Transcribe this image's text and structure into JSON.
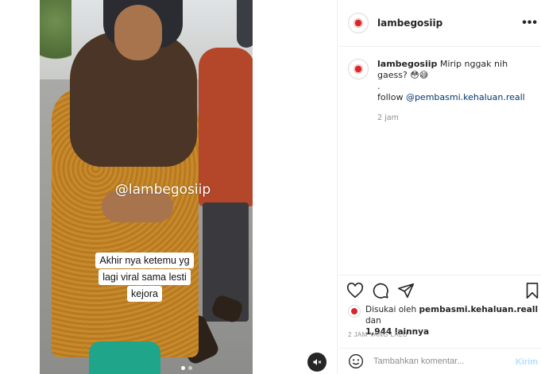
{
  "post": {
    "username": "lambegosiip",
    "video": {
      "watermark": "@lambegosiip",
      "caption_lines": [
        "Akhir nya ketemu yg",
        "lagi viral sama lesti",
        "kejora"
      ],
      "slide_count": 2,
      "active_slide": 1
    }
  },
  "comment": {
    "username": "lambegosiip",
    "text": "Mirip nggak nih gaess?",
    "emoji": "😳😅",
    "dot": ".",
    "follow_label": "follow",
    "mention": "@pembasmi.kehaluan.reall",
    "time": "2 jam"
  },
  "likes": {
    "prefix": "Disukai oleh",
    "user": "pembasmi.kehaluan.reall",
    "connector": "dan",
    "count": "1,944 lainnya"
  },
  "posted_ago": "2 JAM YANG LALU",
  "add_comment": {
    "placeholder": "Tambahkan komentar...",
    "emoji": "☺",
    "post_label": "Kirim"
  },
  "icons": [
    "more-icon",
    "heart-icon",
    "comment-icon",
    "share-icon",
    "bookmark-icon",
    "emoji-icon",
    "mute-icon"
  ],
  "colors": {
    "accent": "#0095f6",
    "link": "#00376b",
    "muted": "#8e8e8e",
    "post_disabled": "#b2dffc"
  }
}
